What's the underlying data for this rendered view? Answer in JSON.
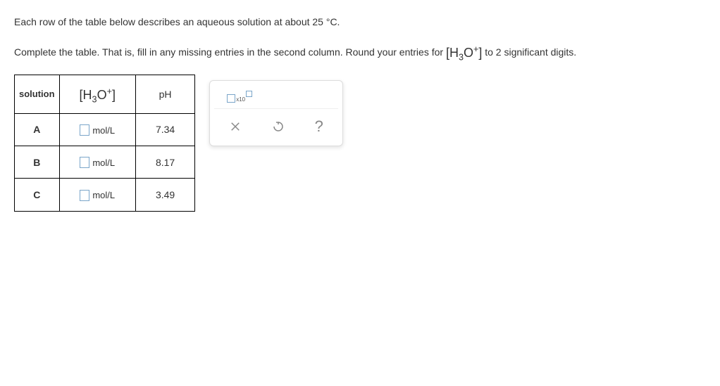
{
  "instructions": {
    "line1": "Each row of the table below describes an aqueous solution at about 25 °C.",
    "line2_before": "Complete the table. That is, fill in any missing entries in the second column. Round your entries for ",
    "line2_after": " to 2 significant digits."
  },
  "table": {
    "headers": {
      "solution": "solution",
      "ph": "pH"
    },
    "unit": "mol/L",
    "rows": [
      {
        "label": "A",
        "ph": "7.34"
      },
      {
        "label": "B",
        "ph": "8.17"
      },
      {
        "label": "C",
        "ph": "3.49"
      }
    ]
  },
  "toolbox": {
    "x10": "x10",
    "help": "?"
  }
}
